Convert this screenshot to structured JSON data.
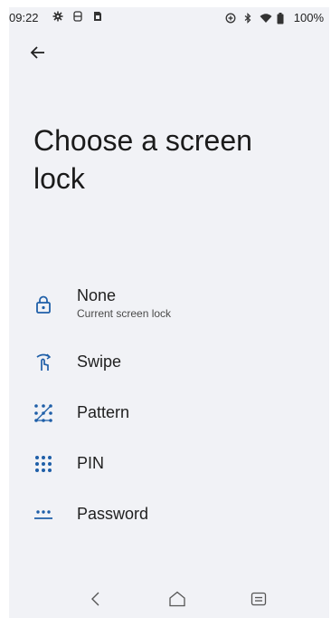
{
  "status_bar": {
    "time": "09:22",
    "battery_percent": "100%",
    "left_icons": [
      "settings-icon",
      "sync-icon",
      "sim-icon"
    ],
    "right_icons": [
      "data-saver-icon",
      "bluetooth-icon",
      "wifi-icon",
      "battery-icon"
    ]
  },
  "header": {
    "back_icon": "arrow-left-icon",
    "title": "Choose a screen lock"
  },
  "options": [
    {
      "label": "None",
      "sublabel": "Current screen lock",
      "icon": "lock-open-icon"
    },
    {
      "label": "Swipe",
      "icon": "swipe-icon"
    },
    {
      "label": "Pattern",
      "icon": "pattern-icon"
    },
    {
      "label": "PIN",
      "icon": "pin-icon"
    },
    {
      "label": "Password",
      "icon": "password-icon"
    }
  ],
  "nav_bar": {
    "back_icon": "nav-back-icon",
    "home_icon": "nav-home-icon",
    "recents_icon": "nav-recents-icon"
  },
  "colors": {
    "accent": "#1f5fa8",
    "background": "#f1f2f6",
    "text": "#1f1f1f"
  }
}
